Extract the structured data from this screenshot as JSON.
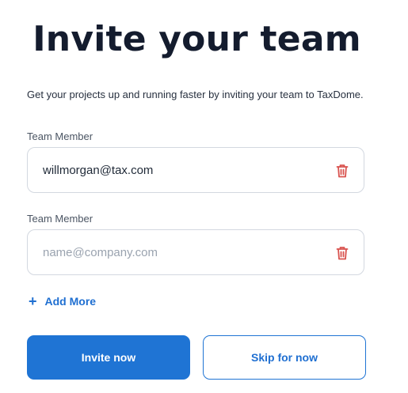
{
  "header": {
    "title": "Invite your team",
    "subtitle": "Get your projects up and running faster by inviting your team to TaxDome."
  },
  "members": [
    {
      "label": "Team Member",
      "value": "willmorgan@tax.com",
      "placeholder": "name@company.com",
      "delete_icon": "trash-icon"
    },
    {
      "label": "Team Member",
      "value": "",
      "placeholder": "name@company.com",
      "delete_icon": "trash-icon"
    }
  ],
  "add_more": {
    "icon": "plus-icon",
    "label": "Add More"
  },
  "actions": {
    "invite_label": "Invite now",
    "skip_label": "Skip for now"
  },
  "colors": {
    "accent": "#1f74d4",
    "delete": "#d9534f",
    "title": "#141c2e"
  }
}
